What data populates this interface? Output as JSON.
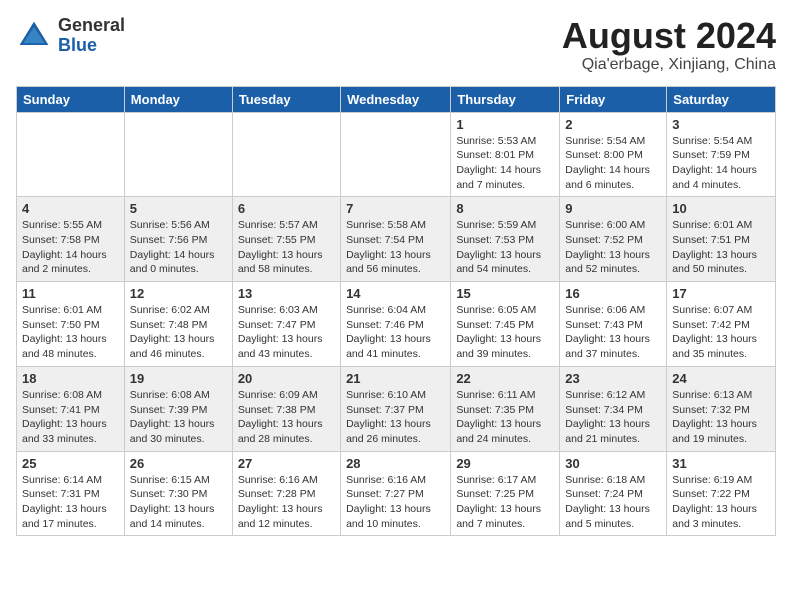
{
  "header": {
    "logo_general": "General",
    "logo_blue": "Blue",
    "month_title": "August 2024",
    "subtitle": "Qia'erbage, Xinjiang, China"
  },
  "weekdays": [
    "Sunday",
    "Monday",
    "Tuesday",
    "Wednesday",
    "Thursday",
    "Friday",
    "Saturday"
  ],
  "weeks": [
    [
      {
        "day": "",
        "info": ""
      },
      {
        "day": "",
        "info": ""
      },
      {
        "day": "",
        "info": ""
      },
      {
        "day": "",
        "info": ""
      },
      {
        "day": "1",
        "info": "Sunrise: 5:53 AM\nSunset: 8:01 PM\nDaylight: 14 hours\nand 7 minutes."
      },
      {
        "day": "2",
        "info": "Sunrise: 5:54 AM\nSunset: 8:00 PM\nDaylight: 14 hours\nand 6 minutes."
      },
      {
        "day": "3",
        "info": "Sunrise: 5:54 AM\nSunset: 7:59 PM\nDaylight: 14 hours\nand 4 minutes."
      }
    ],
    [
      {
        "day": "4",
        "info": "Sunrise: 5:55 AM\nSunset: 7:58 PM\nDaylight: 14 hours\nand 2 minutes."
      },
      {
        "day": "5",
        "info": "Sunrise: 5:56 AM\nSunset: 7:56 PM\nDaylight: 14 hours\nand 0 minutes."
      },
      {
        "day": "6",
        "info": "Sunrise: 5:57 AM\nSunset: 7:55 PM\nDaylight: 13 hours\nand 58 minutes."
      },
      {
        "day": "7",
        "info": "Sunrise: 5:58 AM\nSunset: 7:54 PM\nDaylight: 13 hours\nand 56 minutes."
      },
      {
        "day": "8",
        "info": "Sunrise: 5:59 AM\nSunset: 7:53 PM\nDaylight: 13 hours\nand 54 minutes."
      },
      {
        "day": "9",
        "info": "Sunrise: 6:00 AM\nSunset: 7:52 PM\nDaylight: 13 hours\nand 52 minutes."
      },
      {
        "day": "10",
        "info": "Sunrise: 6:01 AM\nSunset: 7:51 PM\nDaylight: 13 hours\nand 50 minutes."
      }
    ],
    [
      {
        "day": "11",
        "info": "Sunrise: 6:01 AM\nSunset: 7:50 PM\nDaylight: 13 hours\nand 48 minutes."
      },
      {
        "day": "12",
        "info": "Sunrise: 6:02 AM\nSunset: 7:48 PM\nDaylight: 13 hours\nand 46 minutes."
      },
      {
        "day": "13",
        "info": "Sunrise: 6:03 AM\nSunset: 7:47 PM\nDaylight: 13 hours\nand 43 minutes."
      },
      {
        "day": "14",
        "info": "Sunrise: 6:04 AM\nSunset: 7:46 PM\nDaylight: 13 hours\nand 41 minutes."
      },
      {
        "day": "15",
        "info": "Sunrise: 6:05 AM\nSunset: 7:45 PM\nDaylight: 13 hours\nand 39 minutes."
      },
      {
        "day": "16",
        "info": "Sunrise: 6:06 AM\nSunset: 7:43 PM\nDaylight: 13 hours\nand 37 minutes."
      },
      {
        "day": "17",
        "info": "Sunrise: 6:07 AM\nSunset: 7:42 PM\nDaylight: 13 hours\nand 35 minutes."
      }
    ],
    [
      {
        "day": "18",
        "info": "Sunrise: 6:08 AM\nSunset: 7:41 PM\nDaylight: 13 hours\nand 33 minutes."
      },
      {
        "day": "19",
        "info": "Sunrise: 6:08 AM\nSunset: 7:39 PM\nDaylight: 13 hours\nand 30 minutes."
      },
      {
        "day": "20",
        "info": "Sunrise: 6:09 AM\nSunset: 7:38 PM\nDaylight: 13 hours\nand 28 minutes."
      },
      {
        "day": "21",
        "info": "Sunrise: 6:10 AM\nSunset: 7:37 PM\nDaylight: 13 hours\nand 26 minutes."
      },
      {
        "day": "22",
        "info": "Sunrise: 6:11 AM\nSunset: 7:35 PM\nDaylight: 13 hours\nand 24 minutes."
      },
      {
        "day": "23",
        "info": "Sunrise: 6:12 AM\nSunset: 7:34 PM\nDaylight: 13 hours\nand 21 minutes."
      },
      {
        "day": "24",
        "info": "Sunrise: 6:13 AM\nSunset: 7:32 PM\nDaylight: 13 hours\nand 19 minutes."
      }
    ],
    [
      {
        "day": "25",
        "info": "Sunrise: 6:14 AM\nSunset: 7:31 PM\nDaylight: 13 hours\nand 17 minutes."
      },
      {
        "day": "26",
        "info": "Sunrise: 6:15 AM\nSunset: 7:30 PM\nDaylight: 13 hours\nand 14 minutes."
      },
      {
        "day": "27",
        "info": "Sunrise: 6:16 AM\nSunset: 7:28 PM\nDaylight: 13 hours\nand 12 minutes."
      },
      {
        "day": "28",
        "info": "Sunrise: 6:16 AM\nSunset: 7:27 PM\nDaylight: 13 hours\nand 10 minutes."
      },
      {
        "day": "29",
        "info": "Sunrise: 6:17 AM\nSunset: 7:25 PM\nDaylight: 13 hours\nand 7 minutes."
      },
      {
        "day": "30",
        "info": "Sunrise: 6:18 AM\nSunset: 7:24 PM\nDaylight: 13 hours\nand 5 minutes."
      },
      {
        "day": "31",
        "info": "Sunrise: 6:19 AM\nSunset: 7:22 PM\nDaylight: 13 hours\nand 3 minutes."
      }
    ]
  ]
}
